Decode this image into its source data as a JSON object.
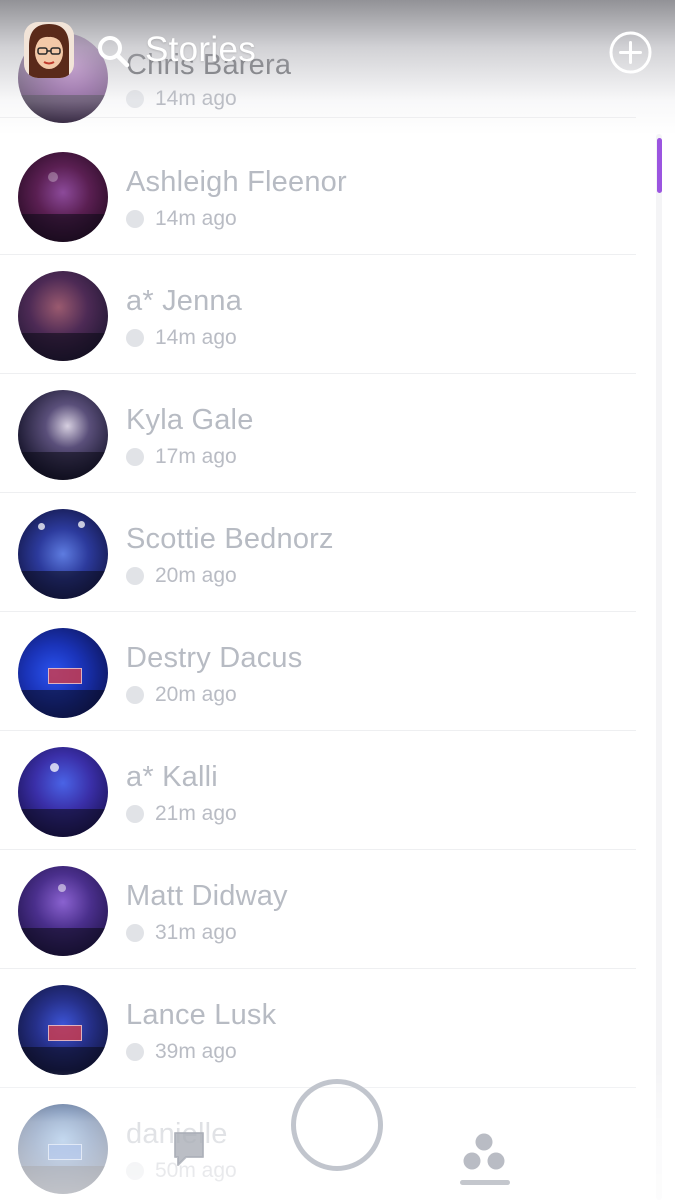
{
  "header": {
    "title": "Stories",
    "bitmoji_icon": "bitmoji-avatar",
    "search_icon": "search-icon",
    "add_icon": "add-circle-icon"
  },
  "stories": [
    {
      "name": "Chris Barera",
      "time": "14m ago"
    },
    {
      "name": "Ashleigh Fleenor",
      "time": "14m ago"
    },
    {
      "name": "a* Jenna",
      "time": "14m ago"
    },
    {
      "name": "Kyla Gale",
      "time": "17m ago"
    },
    {
      "name": "Scottie Bednorz",
      "time": "20m ago"
    },
    {
      "name": "Destry Dacus",
      "time": "20m ago"
    },
    {
      "name": "a* Kalli",
      "time": "21m ago"
    },
    {
      "name": "Matt Didway",
      "time": "31m ago"
    },
    {
      "name": "Lance Lusk",
      "time": "39m ago"
    },
    {
      "name": "danielle",
      "time": "50m ago"
    }
  ],
  "bottom_nav": {
    "left_icon": "chat-icon",
    "center": "capture-button",
    "right_icon": "stories-icon",
    "active": "stories"
  },
  "colors": {
    "accent_scrollbar": "#9b55e0",
    "name_text": "#b7bbc3",
    "time_text": "#b9bcc4",
    "divider": "#eeeff1"
  }
}
